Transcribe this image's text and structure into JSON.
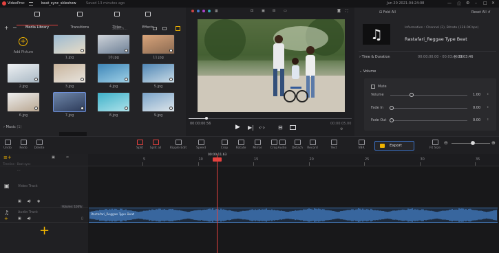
{
  "app": {
    "logo": "VideoProc",
    "project_name": "beat_sync_skleshow",
    "saved_status": "Saved 13 minutes ago",
    "datetime": "Jun 20 2021-04:24:08",
    "colors": {
      "accent": "#e6423f",
      "export": "#f0b400",
      "audio_wave": "#4a8fe0",
      "bg": "#1b1b1d"
    }
  },
  "media_tabs": [
    {
      "label": "Media Library",
      "icon": "media-library-icon",
      "active": true
    },
    {
      "label": "Transitions",
      "icon": "transitions-icon",
      "active": false
    },
    {
      "label": "Titles",
      "icon": "titles-icon",
      "active": false
    },
    {
      "label": "Effects",
      "icon": "effects-icon",
      "active": false
    }
  ],
  "media": {
    "search_placeholder": "Search...",
    "add_picture_label": "Add Picture",
    "thumbnails": [
      {
        "label": "1.jpg",
        "c1": "#9bbad2",
        "c2": "#e9dcc6"
      },
      {
        "label": "10.jpg",
        "c1": "#cfd4da",
        "c2": "#6d7f95"
      },
      {
        "label": "11.jpg",
        "c1": "#d9a47a",
        "c2": "#8a6a52"
      },
      {
        "label": "2.jpg",
        "c1": "#eef1f3",
        "c2": "#a9b8c4"
      },
      {
        "label": "3.jpg",
        "c1": "#c9b49c",
        "c2": "#e7e4de"
      },
      {
        "label": "4.jpg",
        "c1": "#3e86b8",
        "c2": "#9fd0e6"
      },
      {
        "label": "5.jpg",
        "c1": "#4f86b5",
        "c2": "#c9dbe6"
      },
      {
        "label": "6.jpg",
        "c1": "#eeeeee",
        "c2": "#b8a691"
      },
      {
        "label": "7.jpg",
        "c1": "#6e86a8",
        "c2": "#2c3a59"
      },
      {
        "label": "8.jpg",
        "c1": "#3fb1c9",
        "c2": "#aee2ea"
      },
      {
        "label": "9.jpg",
        "c1": "#7aa3c9",
        "c2": "#dde5ea"
      }
    ],
    "music_label": "Music",
    "music_count": "(1)"
  },
  "preview": {
    "current_time": "00:00:00.56",
    "total_time": "00:00:05.00",
    "progress": 0.11
  },
  "info": {
    "fold_all": "Fold All",
    "reset_all": "Reset All",
    "information": "Information : Channel (2), Bitrate (128.0K bps)",
    "track_title": "Rastafari_Reggae Type Beat",
    "time_duration_label": "Time & Duration",
    "time_range": "00:00:00.00 - 00:03:46.38",
    "duration": "00:03:46",
    "volume_section": "Volume",
    "mute_label": "Mute",
    "volume_label": "Volume",
    "volume_value": "1.00",
    "volume_level": 0.28,
    "fade_in_label": "Fade In",
    "fade_in_value": "0.00",
    "fade_out_label": "Fade Out",
    "fade_out_value": "0.00"
  },
  "toolbar": {
    "left": [
      "Undo",
      "Redo",
      "Delete"
    ],
    "middle": [
      "Split",
      "Split all",
      "Ripple Edit",
      "Speed",
      "Crop",
      "Rotate",
      "Mirror",
      "Crop",
      "Audio",
      "Detach",
      "Record",
      "Text"
    ],
    "vbr_label": "VBR",
    "export_label": "Export",
    "fit_size_label": "Fit Size",
    "zoom_level": 0.55
  },
  "timeline": {
    "playhead_time": "00:00:11.63",
    "ruler_ticks": [
      "5",
      "10",
      "15",
      "20",
      "25",
      "30",
      "35"
    ],
    "track_header_caption": "Timeline · Beat sync",
    "video_track_label": "Video Track",
    "audio_track_label": "Audio Track",
    "audio_clip_label": "Rastafari_Reggae Type Beat",
    "volume_badge": "Volume: 100%"
  }
}
